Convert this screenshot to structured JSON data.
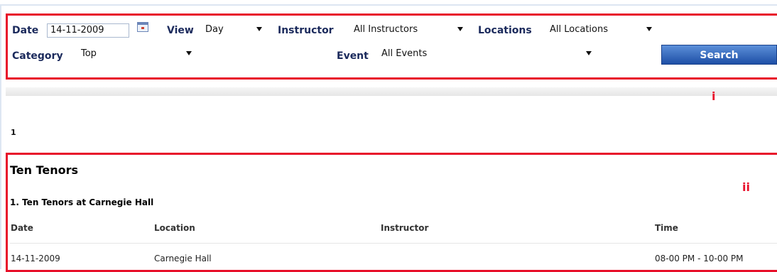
{
  "filters": {
    "date_label": "Date",
    "date_value": "14-11-2009",
    "view_label": "View",
    "view_value": "Day",
    "instructor_label": "Instructor",
    "instructor_value": "All Instructors",
    "locations_label": "Locations",
    "locations_value": "All Locations",
    "category_label": "Category",
    "category_value": "Top",
    "event_label": "Event",
    "event_value": "All Events",
    "search_label": "Search"
  },
  "markers": {
    "first": "i",
    "second": "ii"
  },
  "pagination": {
    "page": "1"
  },
  "event": {
    "title": "Ten Tenors",
    "subtitle": "1. Ten Tenors at Carnegie Hall",
    "columns": [
      "Date",
      "Location",
      "Instructor",
      "Time"
    ],
    "rows": [
      [
        "14-11-2009",
        "Carnegie Hall",
        "",
        "08-00 PM - 10-00 PM"
      ]
    ]
  },
  "colors": {
    "annotation_red": "#e8102a",
    "label_navy": "#1b2a5c",
    "button_blue": "#2a5fb8"
  },
  "icons": [
    "calendar-icon",
    "chevron-down-icon"
  ]
}
